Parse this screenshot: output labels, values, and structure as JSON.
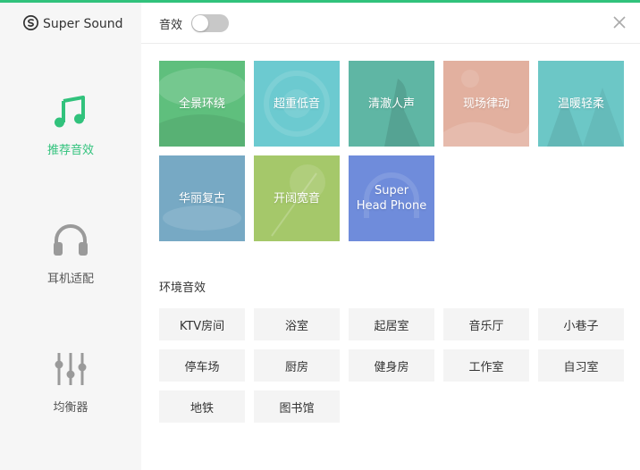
{
  "app": {
    "name": "Super Sound",
    "logo_icon": "super-sound-logo-icon"
  },
  "sidebar": {
    "items": [
      {
        "label": "推荐音效",
        "icon": "music-note-icon",
        "active": true
      },
      {
        "label": "耳机适配",
        "icon": "headphone-icon",
        "active": false
      },
      {
        "label": "均衡器",
        "icon": "equalizer-icon",
        "active": false
      }
    ]
  },
  "header": {
    "sound_effect_label": "音效",
    "toggle_on": false,
    "close_icon": "close-icon"
  },
  "presets": [
    {
      "label": "全景环绕",
      "color": "#5fbf7d"
    },
    {
      "label": "超重低音",
      "color": "#6ccad0"
    },
    {
      "label": "清澈人声",
      "color": "#5fb6a4"
    },
    {
      "label": "现场律动",
      "color": "#e2b09f"
    },
    {
      "label": "温暖轻柔",
      "color": "#6cc7c6"
    },
    {
      "label": "华丽复古",
      "color": "#77a9c4"
    },
    {
      "label": "开阔宽音",
      "color": "#a5c86a"
    },
    {
      "label": "Super\nHead Phone",
      "color": "#6f8cdb"
    }
  ],
  "environment": {
    "title": "环境音效",
    "items": [
      "KTV房间",
      "浴室",
      "起居室",
      "音乐厅",
      "小巷子",
      "停车场",
      "厨房",
      "健身房",
      "工作室",
      "自习室",
      "地铁",
      "图书馆"
    ]
  },
  "colors": {
    "accent": "#31c27c",
    "sidebar_bg": "#f6f6f6",
    "button_bg": "#f4f4f4"
  }
}
